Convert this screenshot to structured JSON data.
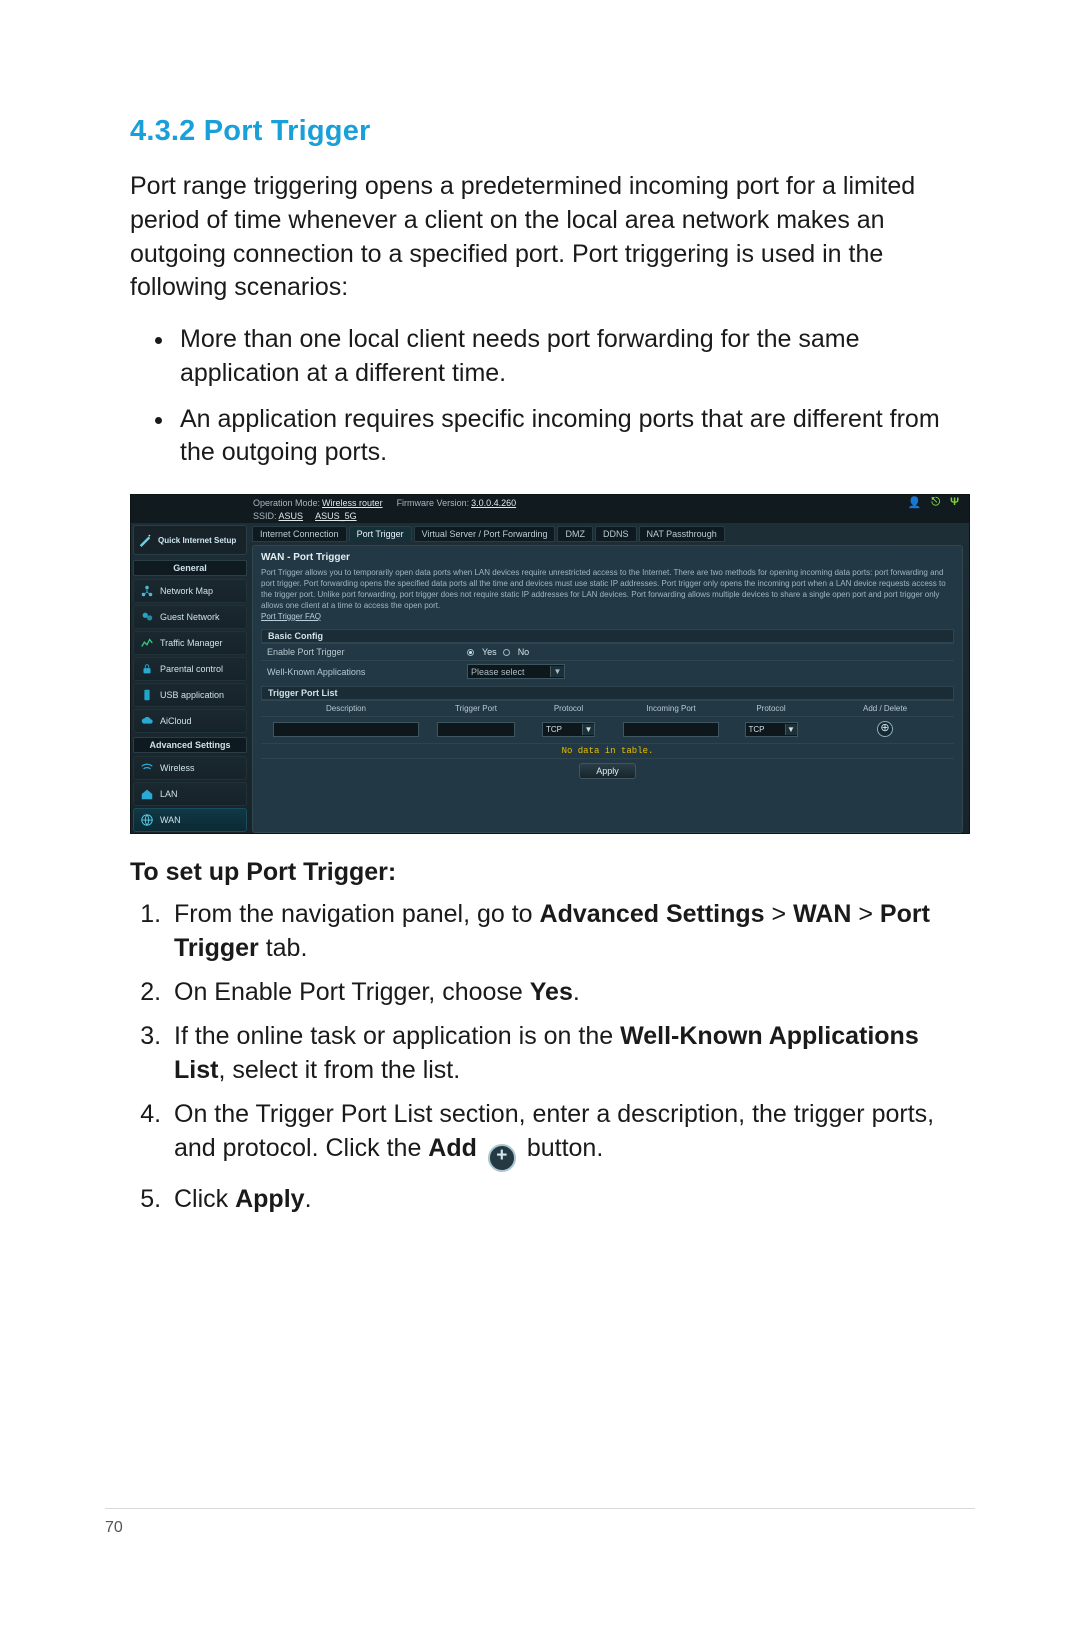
{
  "page_number": "70",
  "section_number": "4.3.2",
  "section_title": "Port Trigger",
  "intro": "Port range triggering opens a predetermined incoming port for a limited period of time whenever a client on the local area network makes an outgoing connection to a specified port. Port triggering is used in the following scenarios:",
  "scenarios": [
    "More than one local client needs port forwarding for the same application at a different time.",
    "An application requires specific incoming ports that are different from the outgoing ports."
  ],
  "setup_heading": "To set up Port Trigger:",
  "steps": {
    "s1_pre": "From the navigation panel, go to ",
    "s1_b1": "Advanced Settings",
    "s1_gt1": " > ",
    "s1_b2": "WAN",
    "s1_gt2": " > ",
    "s1_b3": "Port Trigger",
    "s1_post": " tab.",
    "s2_pre": "On Enable Port Trigger, choose ",
    "s2_b": "Yes",
    "s2_post": ".",
    "s3_pre": "If the online task or application is on the ",
    "s3_b": "Well-Known Applications List",
    "s3_post": ", select it from the list.",
    "s4_pre": "On the Trigger Port List section, enter a description, the trigger ports, and protocol. Click the ",
    "s4_b": "Add",
    "s4_post": " button.",
    "s5_pre": "Click ",
    "s5_b": "Apply",
    "s5_post": "."
  },
  "router": {
    "qis": "Quick Internet Setup",
    "opmode_label": "Operation Mode:",
    "opmode_value": "Wireless router",
    "fw_label": "Firmware Version:",
    "fw_value": "3.0.0.4.260",
    "ssid_label": "SSID:",
    "ssid1": "ASUS",
    "ssid2": "ASUS_5G",
    "sidebar_general": "General",
    "sidebar_adv": "Advanced Settings",
    "side_items_general": [
      "Network Map",
      "Guest Network",
      "Traffic Manager",
      "Parental control",
      "USB application",
      "AiCloud"
    ],
    "side_items_adv": [
      "Wireless",
      "LAN",
      "WAN"
    ],
    "tabs": [
      "Internet Connection",
      "Port Trigger",
      "Virtual Server / Port Forwarding",
      "DMZ",
      "DDNS",
      "NAT Passthrough"
    ],
    "panel_title": "WAN - Port Trigger",
    "panel_desc": "Port Trigger allows you to temporarily open data ports when LAN devices require unrestricted access to the Internet. There are two methods for opening incoming data ports: port forwarding and port trigger. Port forwarding opens the specified data ports all the time and devices must use static IP addresses. Port trigger only opens the incoming port when a LAN device requests access to the trigger port. Unlike port forwarding, port trigger does not require static IP addresses for LAN devices. Port forwarding allows multiple devices to share a single open port and port trigger only allows one client at a time to access the open port.",
    "faq_link": "Port Trigger FAQ",
    "band_basic": "Basic Config",
    "enable_label": "Enable Port Trigger",
    "yes": "Yes",
    "no": "No",
    "wellknown_label": "Well-Known Applications",
    "select_placeholder": "Please select",
    "band_tpl": "Trigger Port List",
    "col_desc": "Description",
    "col_tp": "Trigger Port",
    "col_pro": "Protocol",
    "col_inc": "Incoming Port",
    "col_pro2": "Protocol",
    "col_add": "Add / Delete",
    "proto_value": "TCP",
    "no_data": "No data in table.",
    "apply": "Apply"
  }
}
